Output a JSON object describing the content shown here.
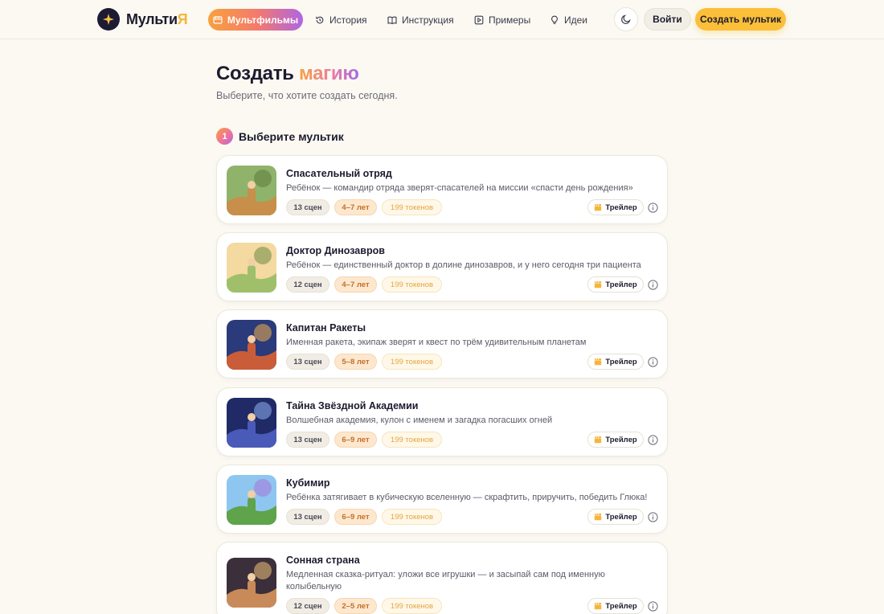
{
  "header": {
    "logo_main": "Мульти",
    "logo_accent": "Я",
    "nav": [
      {
        "label": "Мультфильмы",
        "icon": "film-icon",
        "active": true
      },
      {
        "label": "История",
        "icon": "history-icon"
      },
      {
        "label": "Инструкция",
        "icon": "book-icon"
      },
      {
        "label": "Примеры",
        "icon": "play-square-icon"
      },
      {
        "label": "Идеи",
        "icon": "lightbulb-icon"
      }
    ],
    "theme_icon": "moon-icon",
    "login_label": "Войти",
    "create_label": "Создать мультик"
  },
  "page": {
    "title_main": "Создать",
    "title_accent": "магию",
    "subtitle": "Выберите, что хотите создать сегодня.",
    "step_number": "1",
    "step_label": "Выберите мультик"
  },
  "cards": [
    {
      "title": "Спасательный отряд",
      "description": "Ребёнок — командир отряда зверят-спасателей на миссии «спасти день рождения»",
      "scenes": "13 сцен",
      "age": "4–7 лет",
      "tokens": "199 токенов",
      "trailer": "Трейлер",
      "thumb_colors": [
        "#8fb36a",
        "#c78f4a",
        "#5c7a3a"
      ]
    },
    {
      "title": "Доктор Динозавров",
      "description": "Ребёнок — единственный доктор в долине динозавров, и у него сегодня три пациента",
      "scenes": "12 сцен",
      "age": "4–7 лет",
      "tokens": "199 токенов",
      "trailer": "Трейлер",
      "thumb_colors": [
        "#f4d9a0",
        "#9fbf6a",
        "#6b8a42"
      ]
    },
    {
      "title": "Капитан Ракеты",
      "description": "Именная ракета, экипаж зверят и квест по трём удивительным планетам",
      "scenes": "13 сцен",
      "age": "5–8 лет",
      "tokens": "199 токенов",
      "trailer": "Трейлер",
      "thumb_colors": [
        "#2a3a7a",
        "#c95d3a",
        "#f0b04a"
      ]
    },
    {
      "title": "Тайна Звёздной Академии",
      "description": "Волшебная академия, кулон с именем и загадка погасших огней",
      "scenes": "13 сцен",
      "age": "6–9 лет",
      "tokens": "199 токенов",
      "trailer": "Трейлер",
      "thumb_colors": [
        "#1f2a66",
        "#4a5ab8",
        "#8fb0f0"
      ]
    },
    {
      "title": "Кубимир",
      "description": "Ребёнка затягивает в кубическую вселенную — скрафтить, приручить, победить Глюка!",
      "scenes": "13 сцен",
      "age": "6–9 лет",
      "tokens": "199 токенов",
      "trailer": "Трейлер",
      "thumb_colors": [
        "#8ec6ef",
        "#5fa34a",
        "#a872d8"
      ]
    },
    {
      "title": "Сонная страна",
      "description": "Медленная сказка-ритуал: уложи все игрушки — и засыпай сам под именную колыбельную",
      "scenes": "12 сцен",
      "age": "2–5 лет",
      "tokens": "199 токенов",
      "trailer": "Трейлер",
      "thumb_colors": [
        "#3a2f3a",
        "#c98a5a",
        "#f2c27a"
      ]
    }
  ]
}
